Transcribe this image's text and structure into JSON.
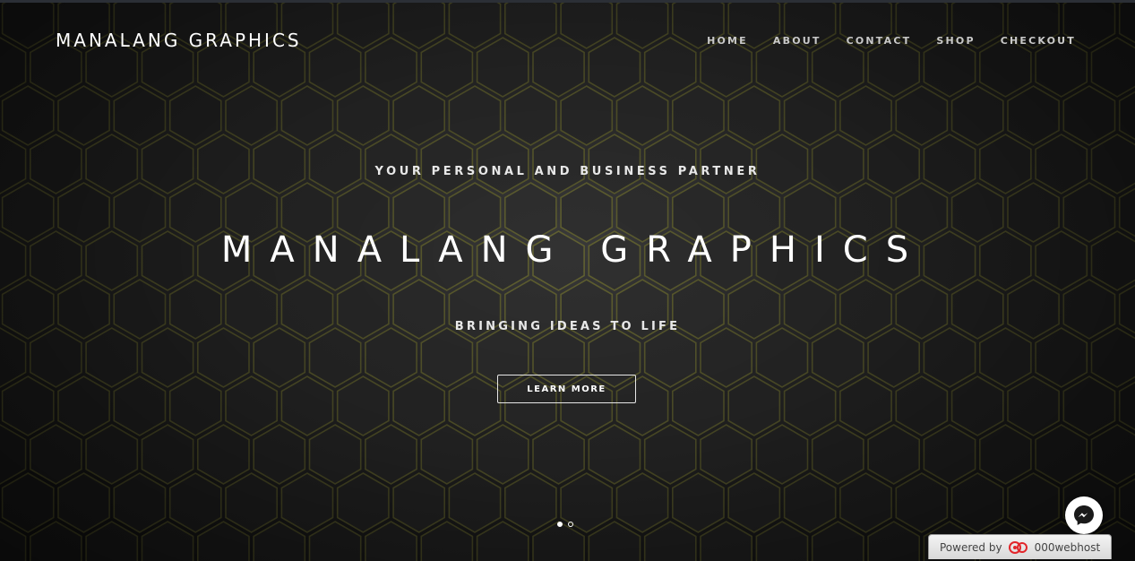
{
  "header": {
    "brand": "MANALANG GRAPHICS",
    "nav": [
      {
        "label": "HOME"
      },
      {
        "label": "ABOUT"
      },
      {
        "label": "CONTACT"
      },
      {
        "label": "SHOP"
      },
      {
        "label": "CHECKOUT"
      }
    ]
  },
  "hero": {
    "tagline": "YOUR PERSONAL AND BUSINESS PARTNER",
    "title": "MANALANG GRAPHICS",
    "subtitle": "BRINGING IDEAS TO LIFE",
    "cta_label": "LEARN MORE",
    "background": "dark hexagon pattern",
    "slides": {
      "count": 2,
      "active": 1
    }
  },
  "widgets": {
    "messenger_icon": "messenger-icon",
    "powered_by_label": "Powered by",
    "powered_by_host": "000webhost",
    "powered_by_logo": "000webhost-logo"
  },
  "colors": {
    "background": "#1a1a1a",
    "text": "#ffffff",
    "nav_text": "#c9c9c9",
    "hex_edge_glow": "#5a5a2a",
    "host_logo_red": "#e2262b"
  }
}
